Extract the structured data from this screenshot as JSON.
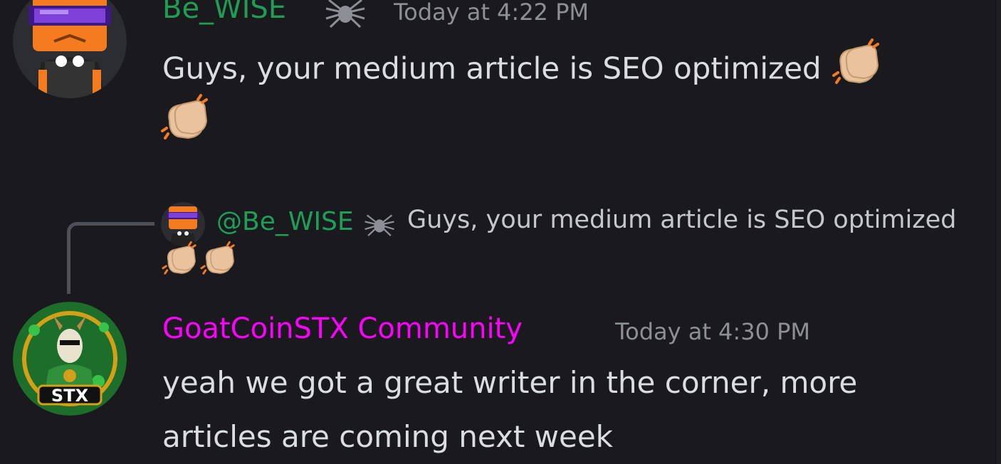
{
  "messages": [
    {
      "author": "Be_WISE",
      "author_color": "#1f9d55",
      "badge_icon": "spider-icon",
      "timestamp": "Today at 4:22 PM",
      "text": "Guys, your medium article is SEO optimized",
      "trailing_emoji": [
        "clapping-hands-emoji",
        "clapping-hands-emoji"
      ]
    },
    {
      "reply": {
        "mention": "@Be_WISE",
        "badge_icon": "spider-icon",
        "text": "Guys, your medium article is SEO optimized",
        "trailing_emoji": [
          "clapping-hands-emoji",
          "clapping-hands-emoji"
        ]
      },
      "author": "GoatCoinSTX Community",
      "author_color": "#ff00ff",
      "timestamp": "Today at 4:30 PM",
      "text_line1": "yeah we got a great writer in the corner, more",
      "text_line2": "articles are coming next week",
      "avatar_label": "STX"
    }
  ],
  "colors": {
    "background": "#1a1a1e",
    "text": "#dbdee1",
    "muted": "#8d8f96"
  }
}
